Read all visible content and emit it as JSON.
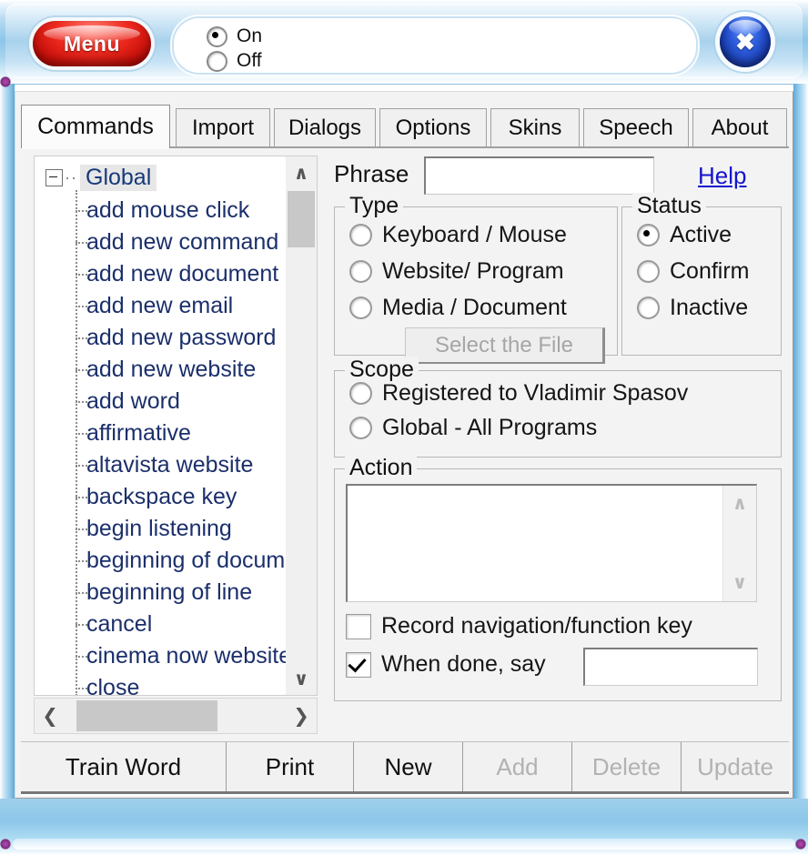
{
  "skin": {
    "menu_button": "Menu",
    "close_button": "✖",
    "listening_radios": [
      {
        "label": "On",
        "selected": true
      },
      {
        "label": "Off",
        "selected": false
      }
    ]
  },
  "tabs": [
    {
      "label": "Commands",
      "active": true
    },
    {
      "label": "Import",
      "active": false
    },
    {
      "label": "Dialogs",
      "active": false
    },
    {
      "label": "Options",
      "active": false
    },
    {
      "label": "Skins",
      "active": false
    },
    {
      "label": "Speech",
      "active": false
    },
    {
      "label": "About",
      "active": false
    }
  ],
  "tree": {
    "root": "Global",
    "items": [
      "add mouse click",
      "add new command",
      "add new document",
      "add new email",
      "add new password",
      "add new website",
      "add word",
      "affirmative",
      "altavista website",
      "backspace key",
      "begin listening",
      "beginning of document",
      "beginning of line",
      "cancel",
      "cinema now website",
      "close"
    ],
    "scroll_up_icon": "∧",
    "scroll_down_icon": "∨",
    "scroll_left_icon": "❮",
    "scroll_right_icon": "❯"
  },
  "form": {
    "phrase_label": "Phrase",
    "phrase_value": "",
    "phrase_placeholder": "",
    "help_link": "Help",
    "type": {
      "legend": "Type",
      "options": [
        {
          "label": "Keyboard / Mouse",
          "selected": false
        },
        {
          "label": "Website/ Program",
          "selected": false
        },
        {
          "label": "Media / Document",
          "selected": false
        }
      ],
      "select_file_button": "Select the File"
    },
    "status": {
      "legend": "Status",
      "options": [
        {
          "label": "Active",
          "selected": true
        },
        {
          "label": "Confirm",
          "selected": false
        },
        {
          "label": "Inactive",
          "selected": false
        }
      ]
    },
    "scope": {
      "legend": "Scope",
      "options": [
        {
          "label": "Registered to Vladimir Spasov",
          "selected": false
        },
        {
          "label": "Global - All Programs",
          "selected": false
        }
      ]
    },
    "action": {
      "legend": "Action",
      "text_value": "",
      "scroll_up_icon": "∧",
      "scroll_down_icon": "∨",
      "record_checkbox": {
        "label": "Record navigation/function key",
        "checked": false
      },
      "whendone_checkbox": {
        "label": "When done, say",
        "checked": true
      },
      "whendone_value": ""
    }
  },
  "buttons": [
    {
      "label": "Train Word",
      "enabled": true
    },
    {
      "label": "Print",
      "enabled": true
    },
    {
      "label": "New",
      "enabled": true
    },
    {
      "label": "Add",
      "enabled": false
    },
    {
      "label": "Delete",
      "enabled": false
    },
    {
      "label": "Update",
      "enabled": false
    }
  ],
  "colors": {
    "skin_blue": "#8cc6e9",
    "menu_red": "#ef2b20",
    "close_blue": "#2f5fe0",
    "link_blue": "#1414cf",
    "tree_text": "#1b2f6b",
    "disabled_text": "#b2b2b2"
  }
}
